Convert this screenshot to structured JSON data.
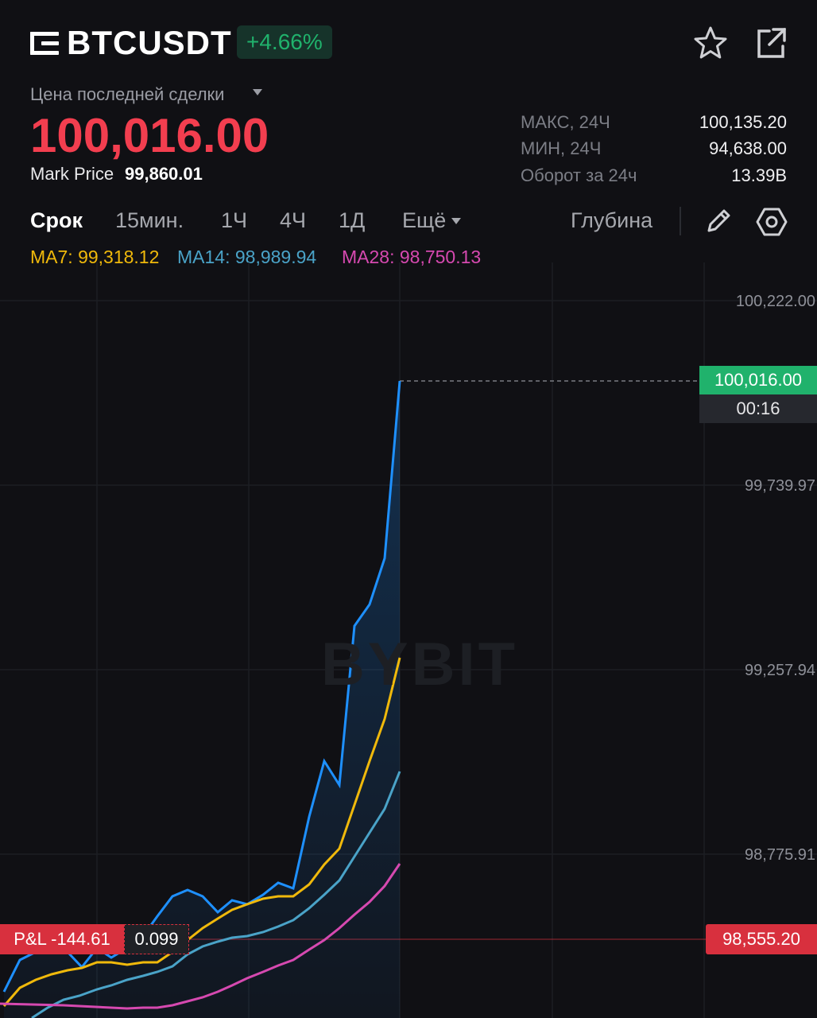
{
  "header": {
    "symbol": "BTCUSDT",
    "change": "+4.66%",
    "menu_icon": "menu-lines-icon",
    "favorite_icon": "star-icon",
    "share_icon": "share-icon"
  },
  "price": {
    "label": "Цена последней сделки",
    "last": "100,016.00",
    "mark_label": "Mark Price",
    "mark_value": "99,860.01"
  },
  "stats": [
    {
      "label": "МАКС, 24Ч",
      "value": "100,135.20"
    },
    {
      "label": "МИН, 24Ч",
      "value": "94,638.00"
    },
    {
      "label": "Оборот за 24ч",
      "value": "13.39B"
    }
  ],
  "timeframes": {
    "active": "Срок",
    "items": [
      "15мин.",
      "1Ч",
      "4Ч",
      "1Д",
      "Ещё"
    ],
    "depth": "Глубина"
  },
  "ma": {
    "ma7": "MA7: 99,318.12",
    "ma14": "MA14: 98,989.94",
    "ma28": "MA28: 98,750.13"
  },
  "colors": {
    "up": "#20b26c",
    "down": "#f23e4f",
    "price_line": "#1e90ff",
    "ma7": "#f0b90b",
    "ma14": "#4aa3c8",
    "ma28": "#d649b0"
  },
  "chart_labels": {
    "y_ticks": [
      "100,222.00",
      "99,739.97",
      "99,257.94",
      "98,775.91"
    ],
    "current_price": "100,016.00",
    "countdown": "00:16",
    "entry_price": "98,555.20",
    "pnl": "P&L -144.61",
    "qty": "0.099",
    "watermark": "BYBIT"
  }
}
